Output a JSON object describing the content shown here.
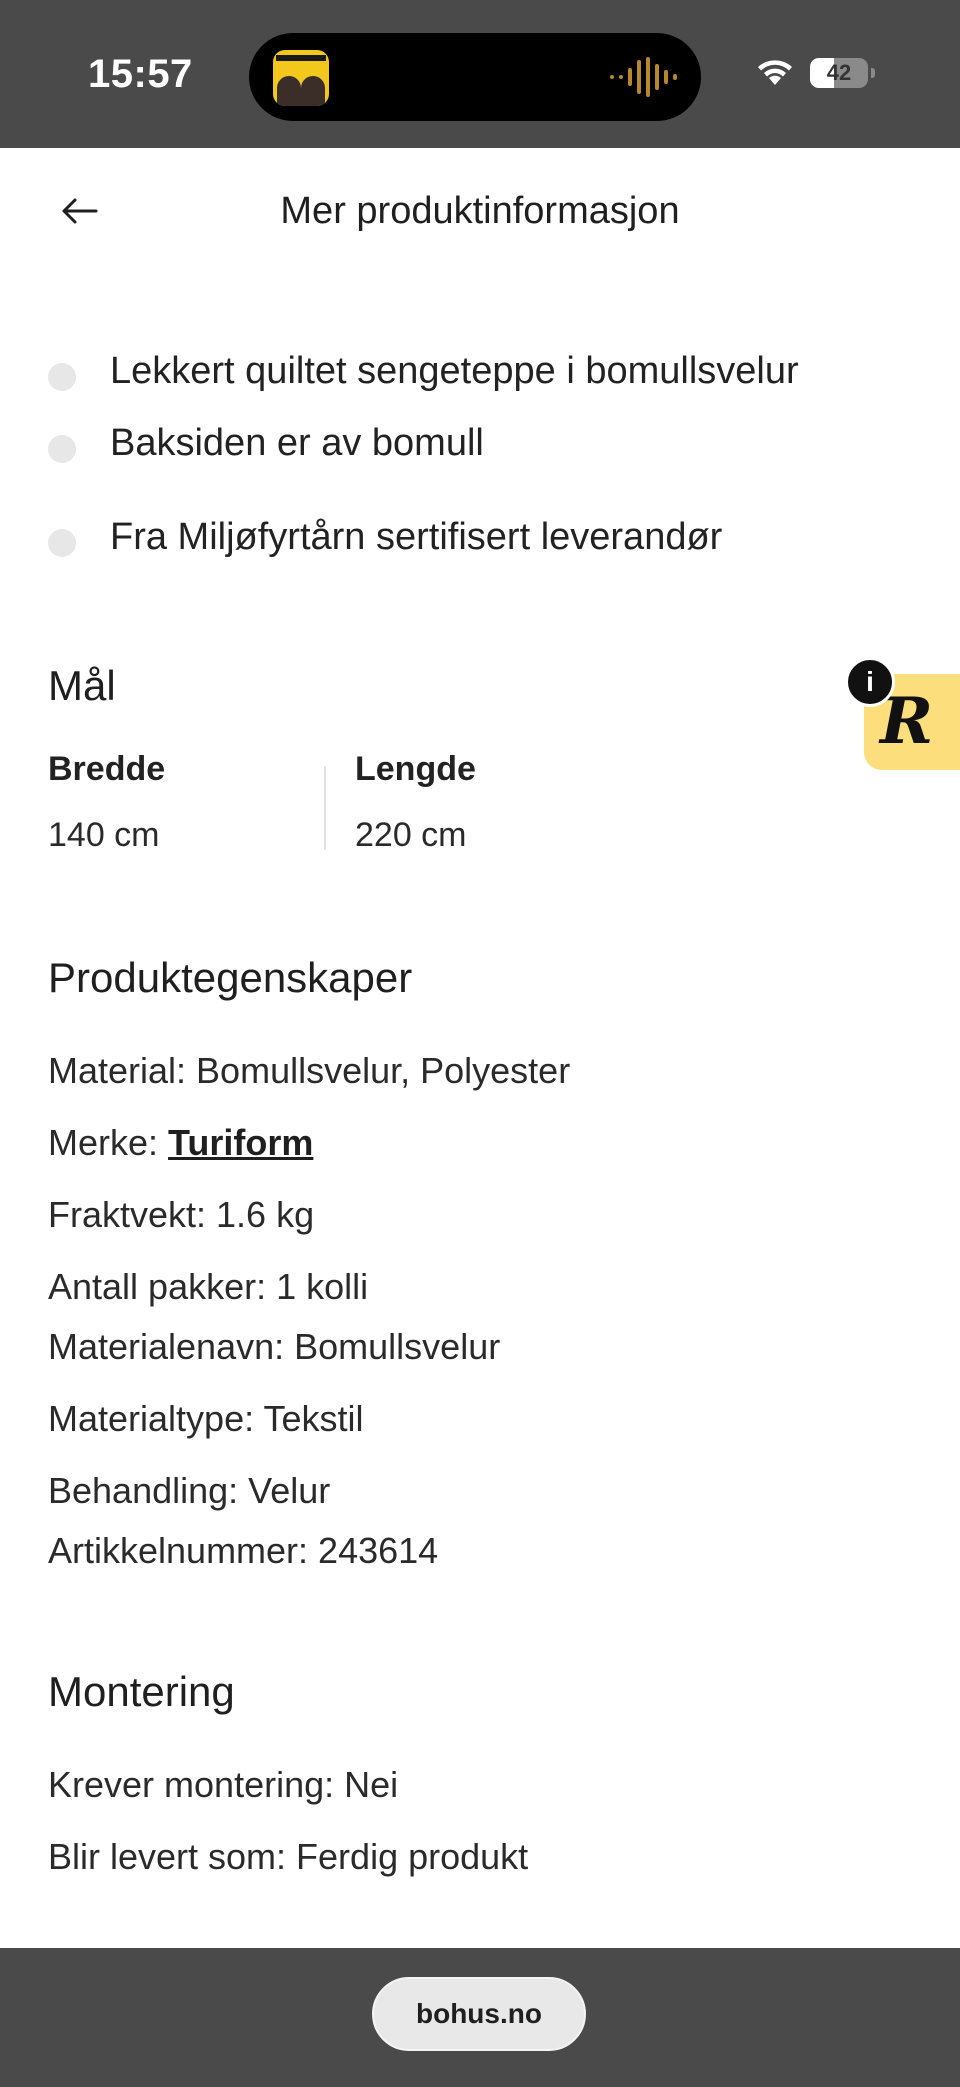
{
  "status_bar": {
    "time": "15:57",
    "battery_level": "42",
    "battery_fraction": 0.42,
    "icons": [
      "podcast-artwork-icon",
      "waveform-icon",
      "wifi-icon",
      "battery-icon"
    ]
  },
  "header": {
    "back_icon": "arrow-left-icon",
    "title": "Mer produktinformasjon"
  },
  "features": [
    "Lekkert quiltet sengeteppe i bomullsvelur",
    "Baksiden er av bomull",
    "Fra Miljøfyrtårn sertifisert leverandør"
  ],
  "dimensions": {
    "heading": "Mål",
    "width_label": "Bredde",
    "width_value": "140 cm",
    "length_label": "Lengde",
    "length_value": "220 cm"
  },
  "properties": {
    "heading": "Produktegenskaper",
    "material": "Material: Bomullsvelur, Polyester",
    "brand_prefix": "Merke: ",
    "brand_link": "Turiform",
    "weight": "Fraktvekt: 1.6 kg",
    "packages": "Antall pakker: 1 kolli",
    "material_name": "Materialenavn: Bomullsvelur",
    "material_type": "Materialtype: Tekstil",
    "treatment": "Behandling: Velur",
    "article_number": "Artikkelnummer: 243614"
  },
  "assembly": {
    "heading": "Montering",
    "requires": "Krever montering: Nei",
    "delivered_as": "Blir levert som: Ferdig produkt"
  },
  "widget": {
    "letter": "R",
    "info": "i"
  },
  "bottom_bar": {
    "url": "bohus.no"
  },
  "colors": {
    "status_bar_bg": "#4a4a4a",
    "widget_bg": "#fcdf7c",
    "bullet_dot": "#e7e7e7",
    "text": "#1f1f1f"
  }
}
